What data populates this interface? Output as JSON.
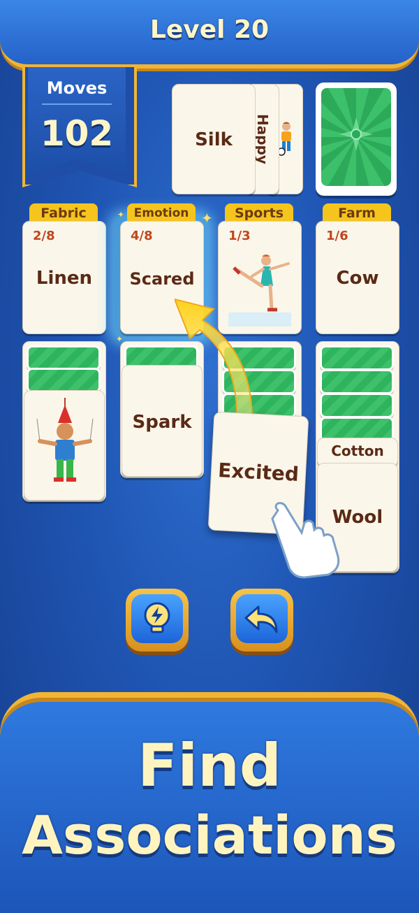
{
  "header": {
    "title": "Level 20"
  },
  "moves": {
    "label": "Moves",
    "value": "102"
  },
  "waste_cards": {
    "top": "Silk",
    "rotated": "Happy"
  },
  "foundations": [
    {
      "category": "Fabric",
      "count": "2/8",
      "word": "Linen"
    },
    {
      "category": "Emotion",
      "count": "4/8",
      "word": "Scared"
    },
    {
      "category": "Sports",
      "count": "1/3",
      "word": ""
    },
    {
      "category": "Farm",
      "count": "1/6",
      "word": "Cow"
    }
  ],
  "tableau": {
    "col2_word": "Spark",
    "col4_label": "Cotton",
    "col4_word": "Wool"
  },
  "dragged_card": {
    "word": "Excited"
  },
  "slogan": {
    "line1": "Find",
    "line2": "Associations"
  },
  "colors": {
    "accent_gold": "#f2b533",
    "card_text": "#5a2a16",
    "count_red": "#c0461e",
    "card_back_green": "#3ec16a"
  },
  "icons": [
    "compass-icon",
    "skater-icon",
    "puppet-icon",
    "soccer-player-icon",
    "hint-bulb-icon",
    "undo-arrow-icon",
    "hand-pointer-icon",
    "drag-arrow-icon",
    "sparkle-icon"
  ]
}
